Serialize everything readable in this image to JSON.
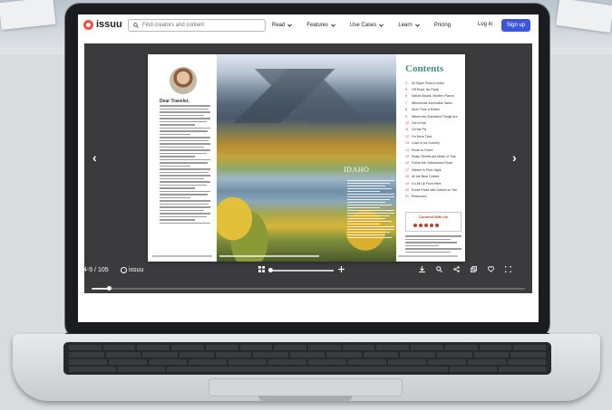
{
  "colors": {
    "accent": "#3d56d6",
    "brand": "#f0503c",
    "contents_title": "#4d8a82",
    "viewer_bg": "#3b3b3d"
  },
  "nav": {
    "brand": "issuu",
    "search_placeholder": "Find creators and content",
    "links": [
      {
        "label": "Read",
        "has_chevron": true
      },
      {
        "label": "Features",
        "has_chevron": true
      },
      {
        "label": "Use Cases",
        "has_chevron": true
      },
      {
        "label": "Learn",
        "has_chevron": true
      },
      {
        "label": "Pricing",
        "has_chevron": false
      }
    ],
    "login": "Log in",
    "signup": "Sign up"
  },
  "viewer": {
    "prev_icon": "‹",
    "next_icon": "›",
    "page_count": "4-5 / 105",
    "brand": "issuu",
    "progress": 0.04,
    "zoom_level": 0.0
  },
  "spread": {
    "letter_greeting": "Dear Traveler,",
    "photo_logo": "IDAHO",
    "contents_title": "Contents",
    "contents": [
      {
        "num": "4",
        "text": "All Signs Point to Idaho"
      },
      {
        "num": "5",
        "text": "Off Road, No Panic"
      },
      {
        "num": "6",
        "text": "Nature Awaits, Modern Places"
      },
      {
        "num": "7",
        "text": "Wheelchair Accessible Idaho"
      },
      {
        "num": "8",
        "text": "More Than a Rodeo"
      },
      {
        "num": "9",
        "text": "Where the Sunbaked Things Are"
      },
      {
        "num": "10",
        "text": "Get a Kick"
      },
      {
        "num": "11",
        "text": "On the Fly"
      },
      {
        "num": "12",
        "text": "On Drive Time"
      },
      {
        "num": "13",
        "text": "Once in Ice Country"
      },
      {
        "num": "14",
        "text": "Room to Roam"
      },
      {
        "num": "15",
        "text": "Sharp Streets are Made of This"
      },
      {
        "num": "16",
        "text": "Follow the Yellowstone Road"
      },
      {
        "num": "17",
        "text": "Hidden in Plain Sight"
      },
      {
        "num": "18",
        "text": "All the Bear Guides"
      },
      {
        "num": "19",
        "text": "Go All Up Front Here"
      },
      {
        "num": "20",
        "text": "Route Parks with Games so Tall"
      },
      {
        "num": "21",
        "text": "Resources"
      }
    ],
    "connect_title": "Connect With Us"
  }
}
